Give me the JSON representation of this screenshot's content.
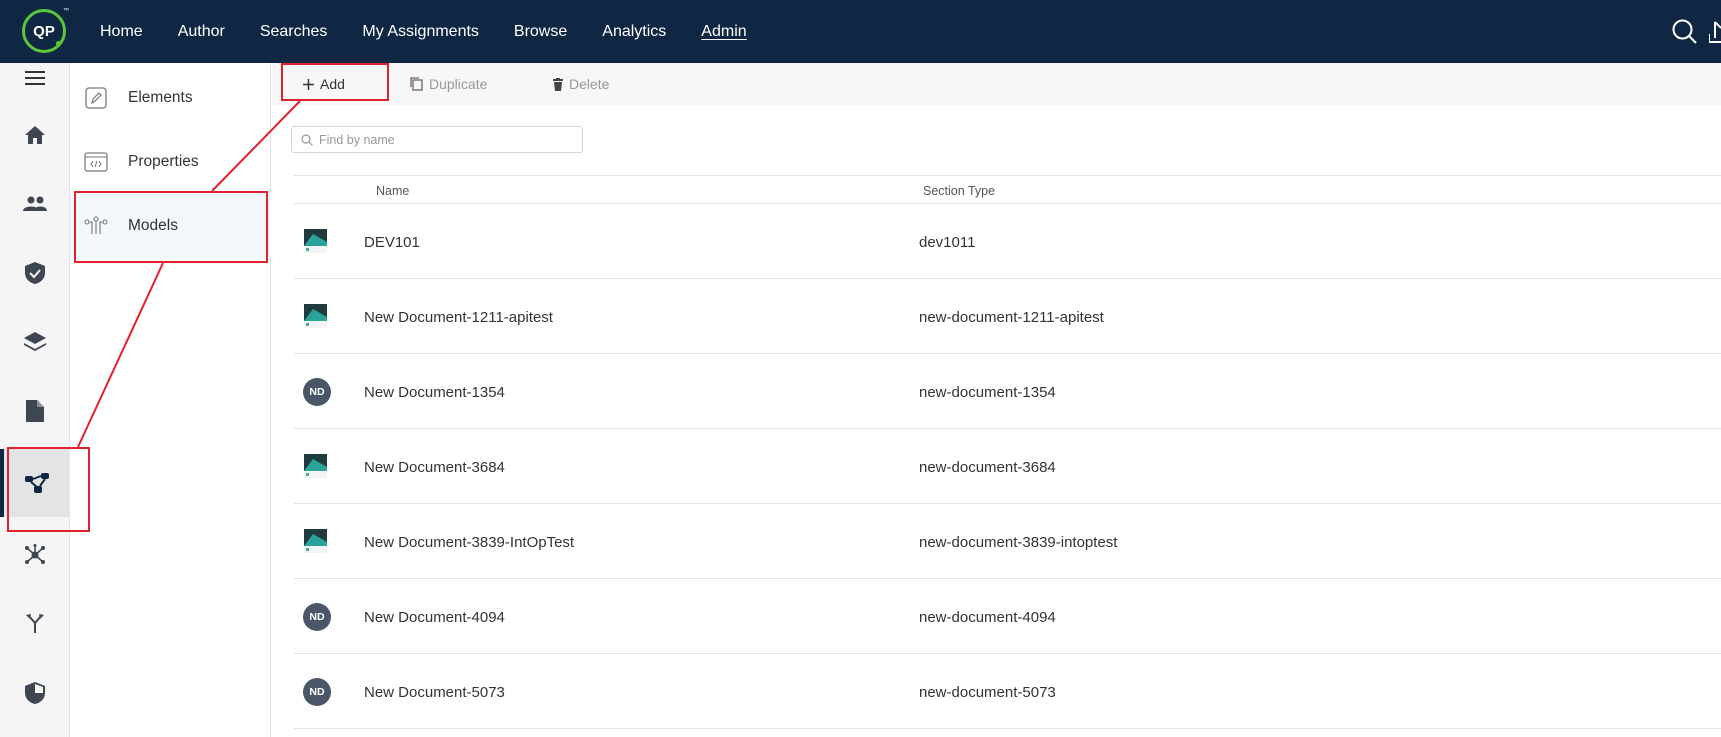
{
  "header": {
    "logo_text": "QP",
    "logo_tm": "™",
    "nav": [
      "Home",
      "Author",
      "Searches",
      "My Assignments",
      "Browse",
      "Analytics",
      "Admin"
    ],
    "active_nav": "Admin"
  },
  "subnav": {
    "items": [
      {
        "label": "Elements",
        "icon": "pencil-icon"
      },
      {
        "label": "Properties",
        "icon": "code-window-icon"
      },
      {
        "label": "Models",
        "icon": "models-icon"
      }
    ],
    "active": "Models"
  },
  "toolbar": {
    "add_label": "Add",
    "duplicate_label": "Duplicate",
    "delete_label": "Delete"
  },
  "search": {
    "placeholder": "Find by name"
  },
  "table": {
    "columns": [
      "Name",
      "Section Type"
    ],
    "rows": [
      {
        "name": "DEV101",
        "section_type": "dev1011",
        "avatar": "thumb"
      },
      {
        "name": "New Document-1211-apitest",
        "section_type": "new-document-1211-apitest",
        "avatar": "thumb"
      },
      {
        "name": "New Document-1354",
        "section_type": "new-document-1354",
        "avatar": "ND"
      },
      {
        "name": "New Document-3684",
        "section_type": "new-document-3684",
        "avatar": "thumb"
      },
      {
        "name": "New Document-3839-IntOpTest",
        "section_type": "new-document-3839-intoptest",
        "avatar": "thumb"
      },
      {
        "name": "New Document-4094",
        "section_type": "new-document-4094",
        "avatar": "ND"
      },
      {
        "name": "New Document-5073",
        "section_type": "new-document-5073",
        "avatar": "ND"
      }
    ]
  },
  "colors": {
    "header_bg": "#0f2742",
    "logo_ring": "#5cc63a",
    "annotation": "#e0212e",
    "avatar_bg": "#4b5768"
  }
}
